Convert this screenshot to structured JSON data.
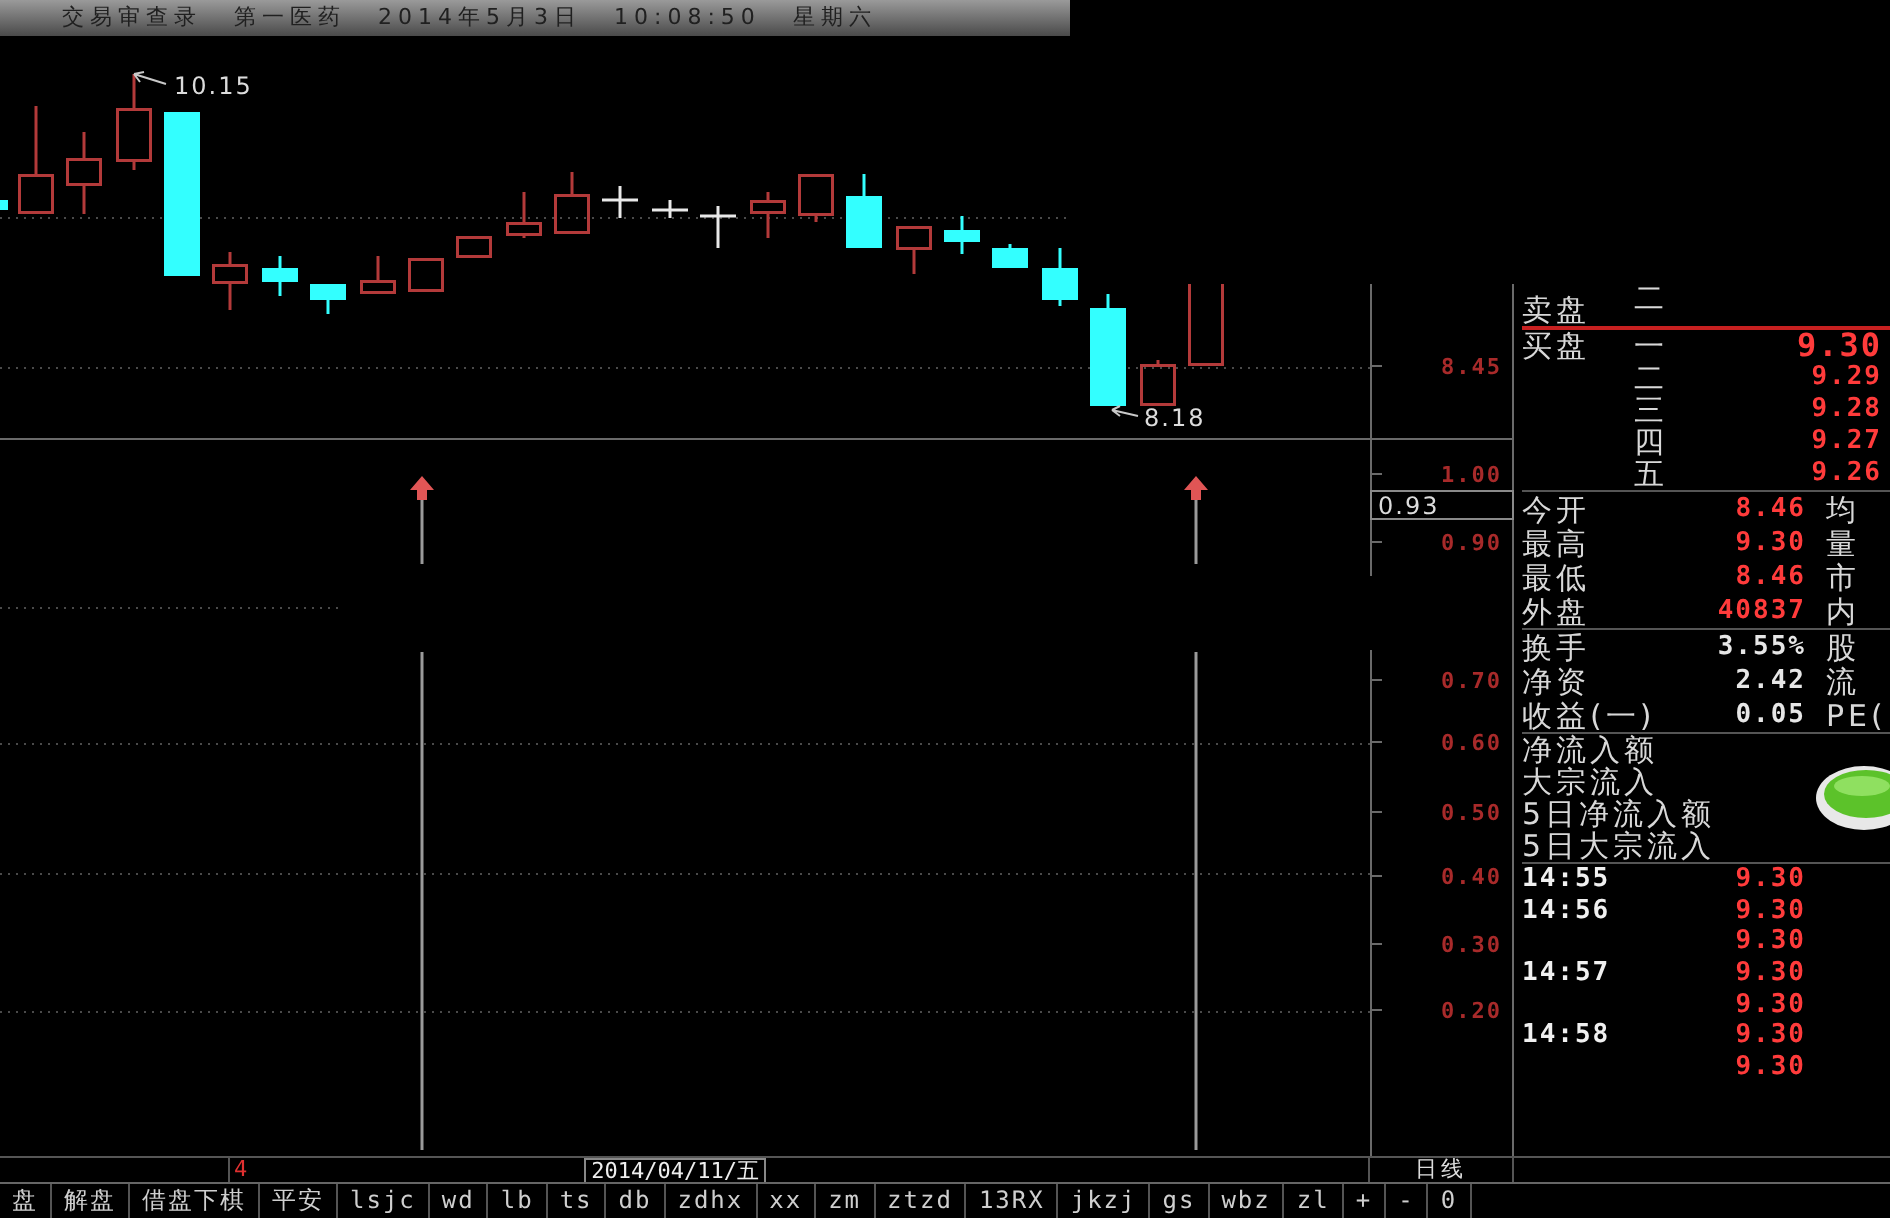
{
  "title_bar": {
    "app": "交易审查录",
    "stock": "第一医药",
    "date": "2014年5月3日",
    "time": "10:08:50",
    "weekday": "星期六"
  },
  "price_chart": {
    "high_label": "10.15",
    "low_label": "8.18",
    "axis_labels": [
      "8.45"
    ]
  },
  "indicator_chart": {
    "axis_labels": [
      "1.00",
      "0.90",
      "0.70",
      "0.60",
      "0.50",
      "0.40",
      "0.30",
      "0.20"
    ],
    "current_value": "0.93"
  },
  "order_book": {
    "sell": {
      "label": "卖盘",
      "levels": [
        {
          "level": "二"
        }
      ]
    },
    "buy": {
      "label": "买盘",
      "levels": [
        {
          "level": "一",
          "price": "9.30"
        },
        {
          "level": "二",
          "price": "9.29"
        },
        {
          "level": "三",
          "price": "9.28"
        },
        {
          "level": "四",
          "price": "9.27"
        },
        {
          "level": "五",
          "price": "9.26"
        }
      ]
    }
  },
  "quote_stats": [
    {
      "label": "今开",
      "value": "8.46",
      "color": "#ff3b3b",
      "label_2": "均"
    },
    {
      "label": "最高",
      "value": "9.30",
      "color": "#ff3b3b",
      "label_2": "量"
    },
    {
      "label": "最低",
      "value": "8.46",
      "color": "#ff3b3b",
      "label_2": "市"
    },
    {
      "label": "外盘",
      "value": "40837",
      "color": "#ff3b3b",
      "label_2": "内"
    }
  ],
  "finance_stats": [
    {
      "label": "换手",
      "value": "3.55%",
      "color": "#e6e6e6",
      "label_2": "股"
    },
    {
      "label": "净资",
      "value": "2.42",
      "color": "#e6e6e6",
      "label_2": "流"
    },
    {
      "label": "收益(一)",
      "value": "0.05",
      "color": "#e6e6e6",
      "label_2": "PE("
    }
  ],
  "fund_flow": [
    "净流入额",
    "大宗流入",
    "5日净流入额",
    "5日大宗流入"
  ],
  "ticks": [
    {
      "time": "14:55",
      "price": "9.30"
    },
    {
      "time": "14:56",
      "price": "9.30"
    },
    {
      "price": "9.30"
    },
    {
      "time": "14:57",
      "price": "9.30"
    },
    {
      "price": "9.30"
    },
    {
      "time": "14:58",
      "price": "9.30"
    },
    {
      "price": "9.30"
    }
  ],
  "date_bar": {
    "marker": "4",
    "date": "2014/04/11/五",
    "period": "日线"
  },
  "bottom_tabs": [
    "盘",
    "解盘",
    "借盘下棋",
    "平安",
    "lsjc",
    "wd",
    "lb",
    "ts",
    "db",
    "zdhx",
    "xx",
    "zm",
    "ztzd",
    "13RX",
    "jkzj",
    "gs",
    "wbz",
    "zl",
    "+",
    "-",
    "0"
  ]
}
